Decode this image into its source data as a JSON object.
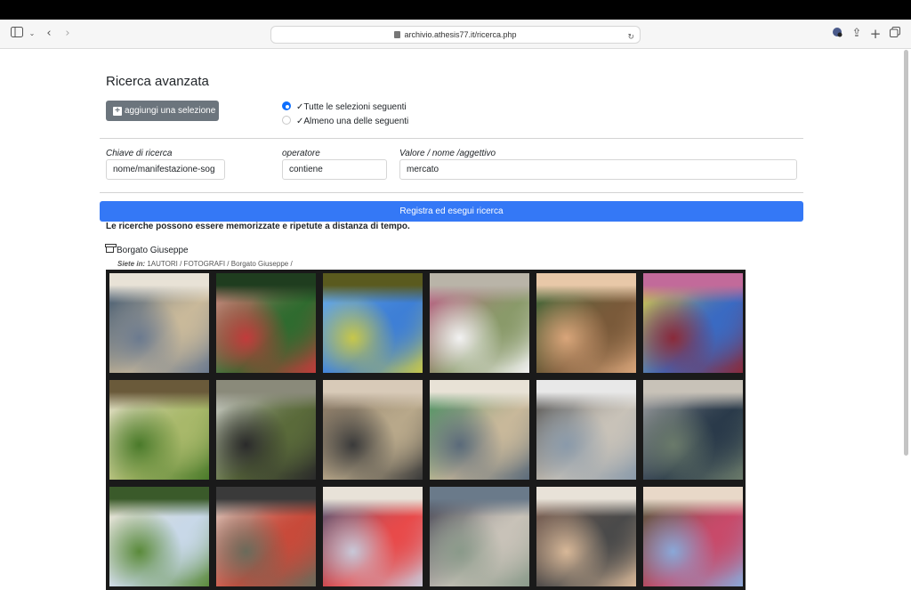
{
  "browser": {
    "url": "archivio.athesis77.it/ricerca.php"
  },
  "page": {
    "title": "Ricerca avanzata",
    "add_selection_label": "aggiungi una selezione",
    "match_options": [
      {
        "label": "Tutte le selezioni seguenti",
        "selected": true
      },
      {
        "label": "Almeno una delle seguenti",
        "selected": false
      }
    ],
    "fields": {
      "key_label": "Chiave di ricerca",
      "key_value": "nome/manifestazione-sog",
      "operator_label": "operatore",
      "operator_value": "contiene",
      "value_label": "Valore / nome /aggettivo",
      "value_value": "mercato"
    },
    "submit_label": "Registra ed esegui ricerca",
    "note": "Le ricerche possono essere memorizzate e ripetute a distanza di tempo."
  },
  "result": {
    "author": "Borgato Giuseppe",
    "crumb_prefix": "Siete in:",
    "crumb_path": "1AUTORI / FOTOGRAFI / Borgato Giuseppe /"
  },
  "colors": {
    "primary": "#3478f6",
    "secondary": "#6c757d"
  },
  "thumbnails": [
    {
      "palette": [
        "#6b7a8f",
        "#c9b99a",
        "#2d4a6b",
        "#e8e2d6"
      ]
    },
    {
      "palette": [
        "#c23b3b",
        "#2f6b2f",
        "#e88a8a",
        "#1f3d1f"
      ]
    },
    {
      "palette": [
        "#c7c74a",
        "#3e7fd6",
        "#6fb1e8",
        "#5a5a1e"
      ]
    },
    {
      "palette": [
        "#f2f2f2",
        "#8a9a6a",
        "#c25a8a",
        "#b9b4a8"
      ]
    },
    {
      "palette": [
        "#d9a57a",
        "#7a5a3a",
        "#3e6b3a",
        "#e8c8a8"
      ]
    },
    {
      "palette": [
        "#8a2a3a",
        "#3a6ac2",
        "#e8d23a",
        "#c26a9a"
      ]
    },
    {
      "palette": [
        "#4a7a2a",
        "#a8b86a",
        "#e8e2d2",
        "#6a5a3a"
      ]
    },
    {
      "palette": [
        "#2a2a2a",
        "#5a6a3a",
        "#d8d8d8",
        "#8a8a7a"
      ]
    },
    {
      "palette": [
        "#3a3a3a",
        "#b8a88a",
        "#7a6a5a",
        "#d8cab8"
      ]
    },
    {
      "palette": [
        "#5a6a7a",
        "#c8b89a",
        "#3a8a5a",
        "#e8e2d6"
      ]
    },
    {
      "palette": [
        "#8a9aaa",
        "#c8c2b8",
        "#4a4a4a",
        "#e8e8e8"
      ]
    },
    {
      "palette": [
        "#6a7a6a",
        "#2a3a4a",
        "#a8a8a8",
        "#c8c2b8"
      ]
    },
    {
      "palette": [
        "#5a8a3a",
        "#c8d8e8",
        "#e8e2c8",
        "#3a5a2a"
      ]
    },
    {
      "palette": [
        "#6a6a5a",
        "#c84a3a",
        "#d8d2c8",
        "#3a3a3a"
      ]
    },
    {
      "palette": [
        "#c8c8d8",
        "#e84a4a",
        "#4a5a7a",
        "#e8e2d8"
      ]
    },
    {
      "palette": [
        "#8a9a8a",
        "#c8c2b8",
        "#3a3a4a",
        "#6a7a8a"
      ]
    },
    {
      "palette": [
        "#d8b898",
        "#4a4a4a",
        "#8a6a5a",
        "#e8e2d8"
      ]
    },
    {
      "palette": [
        "#8aa8d8",
        "#c84a6a",
        "#4a5a3a",
        "#e8d8c8"
      ]
    }
  ]
}
